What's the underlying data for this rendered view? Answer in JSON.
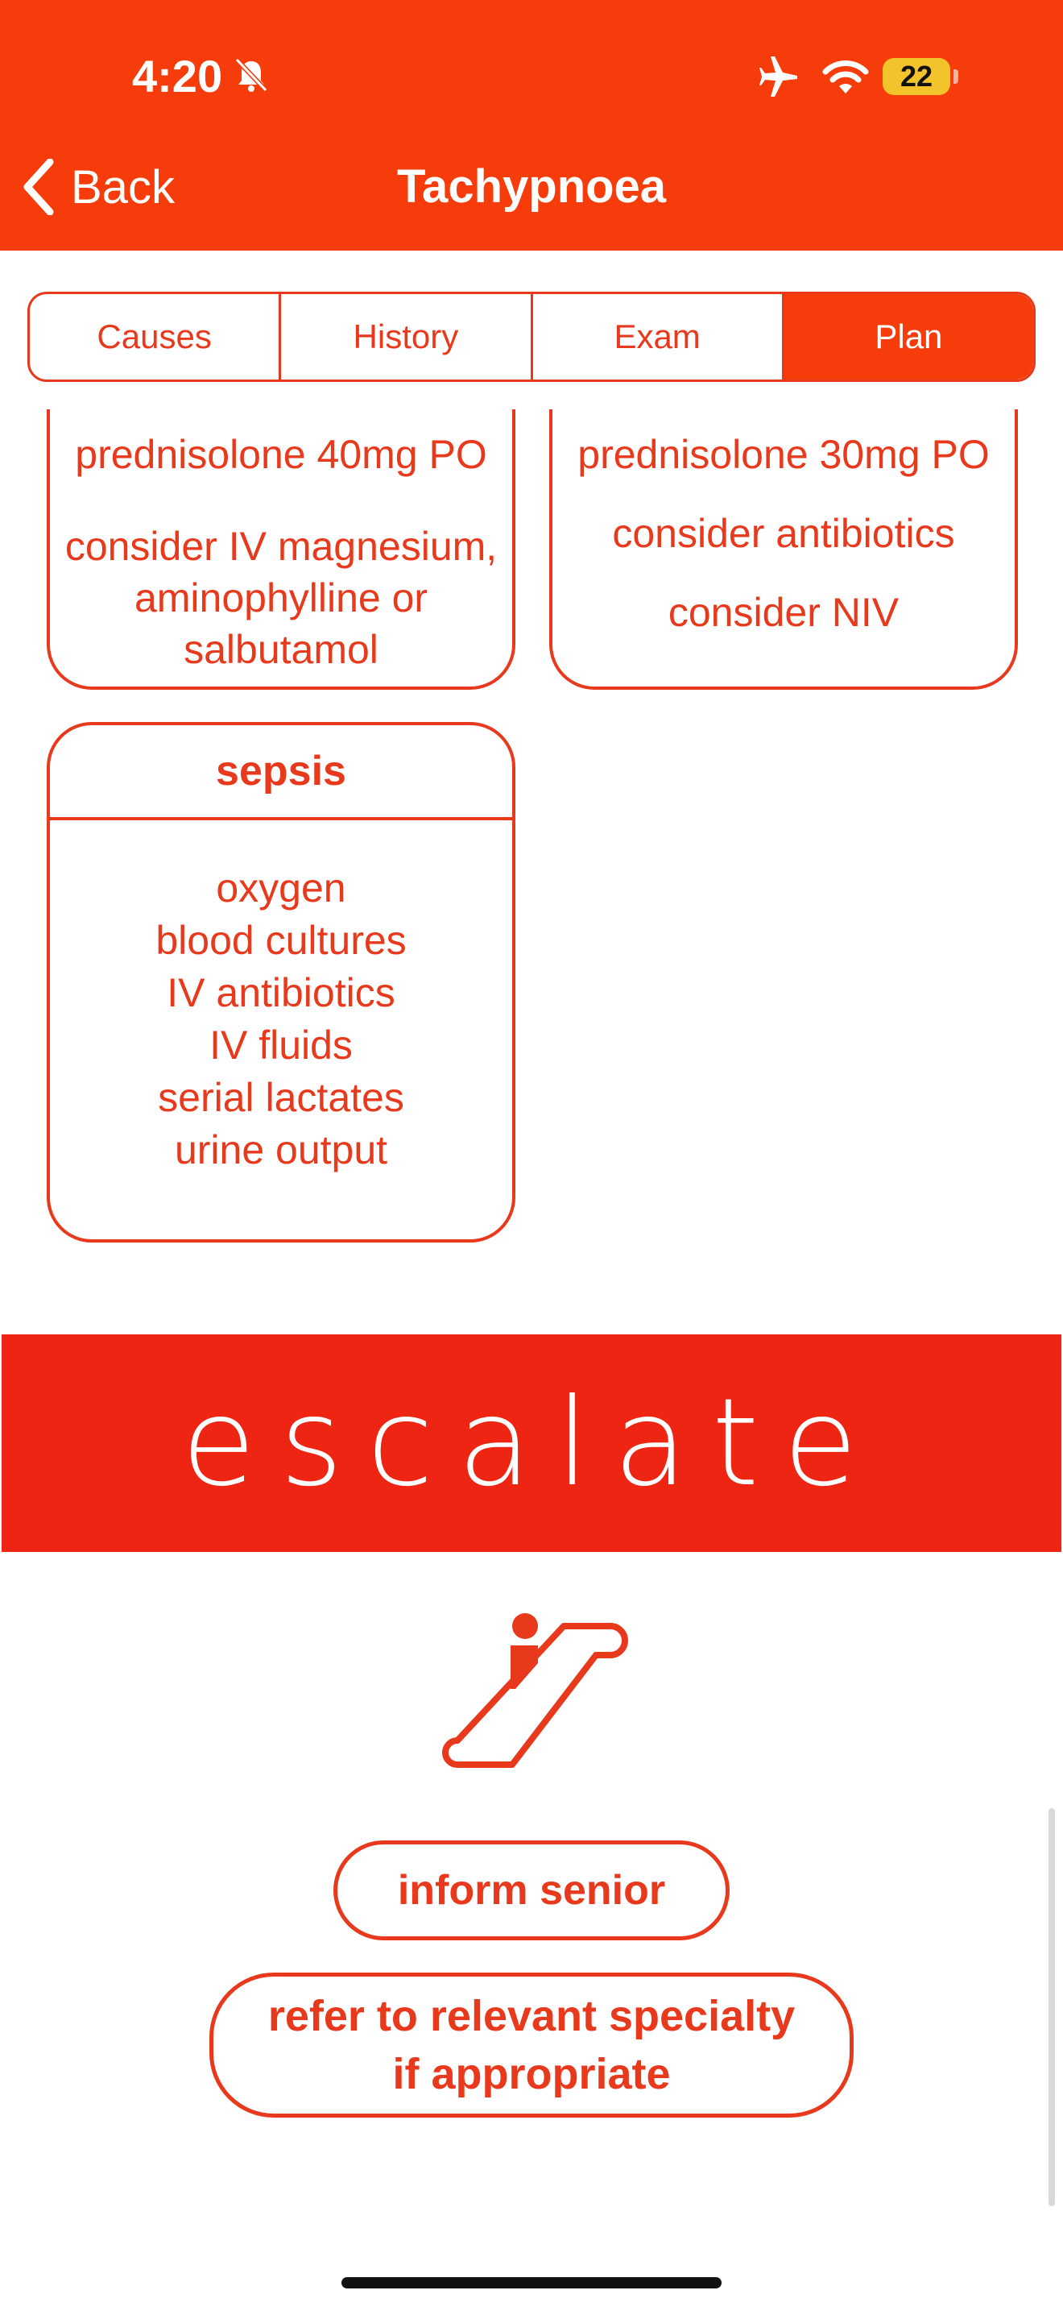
{
  "status_bar": {
    "time": "4:20",
    "battery": "22"
  },
  "nav": {
    "back_label": "Back",
    "title": "Tachypnoea"
  },
  "tabs": [
    {
      "label": "Causes"
    },
    {
      "label": "History"
    },
    {
      "label": "Exam"
    },
    {
      "label": "Plan",
      "selected": true
    }
  ],
  "cards": {
    "left_top": {
      "lines": [
        "prednisolone 40mg PO",
        "consider IV magnesium,",
        "aminophylline or",
        "salbutamol"
      ]
    },
    "right_top": {
      "lines": [
        "prednisolone 30mg PO",
        "consider antibiotics",
        "consider NIV"
      ]
    },
    "sepsis": {
      "title": "sepsis",
      "items": [
        "oxygen",
        "blood cultures",
        "IV antibiotics",
        "IV fluids",
        "serial lactates",
        "urine output"
      ]
    }
  },
  "escalate": {
    "banner_text": "escalate",
    "actions": [
      {
        "label": "inform senior"
      },
      {
        "label_line1": "refer to relevant specialty",
        "label_line2": "if appropriate"
      }
    ]
  },
  "colors": {
    "header": "#F53C0A",
    "accent": "#E8391C",
    "banner": "#EE2512"
  }
}
